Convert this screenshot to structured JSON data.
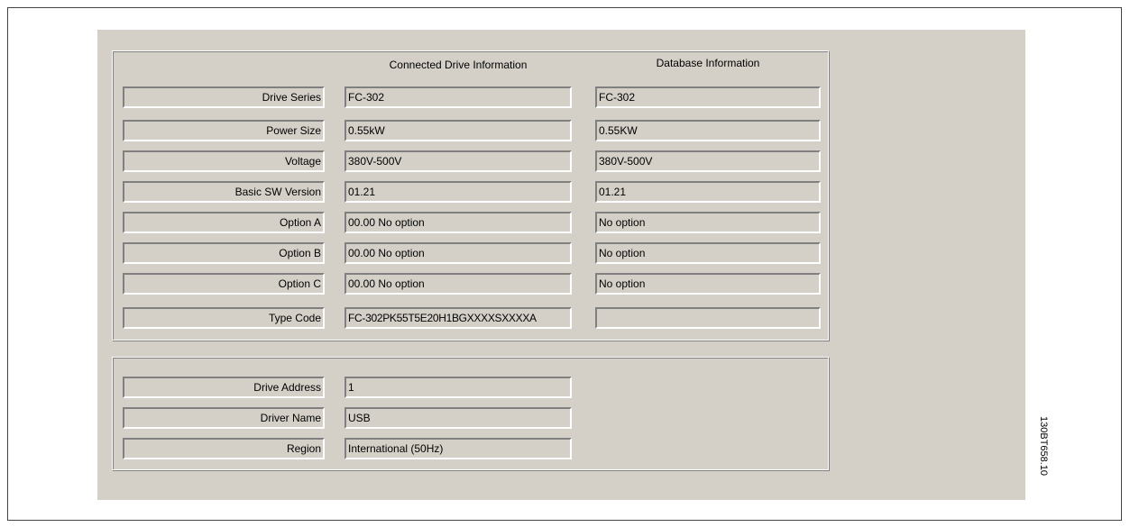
{
  "columns": {
    "connected": "Connected Drive Information",
    "database": "Database Information"
  },
  "rows": [
    {
      "label": "Drive Series",
      "connected": "FC-302",
      "database": "FC-302"
    },
    {
      "label": "Power Size",
      "connected": "0.55kW",
      "database": "0.55KW"
    },
    {
      "label": "Voltage",
      "connected": "380V-500V",
      "database": "380V-500V"
    },
    {
      "label": "Basic SW Version",
      "connected": "01.21",
      "database": "01.21"
    },
    {
      "label": "Option A",
      "connected": "00.00 No option",
      "database": "No option"
    },
    {
      "label": "Option B",
      "connected": "00.00 No option",
      "database": "No option"
    },
    {
      "label": "Option C",
      "connected": "00.00 No option",
      "database": "No option"
    },
    {
      "label": "Type Code",
      "connected": "FC-302PK55T5E20H1BGXXXXSXXXXA",
      "database": ""
    }
  ],
  "connection": [
    {
      "label": "Drive Address",
      "value": "1"
    },
    {
      "label": "Driver Name",
      "value": "USB"
    },
    {
      "label": "Region",
      "value": "International (50Hz)"
    }
  ],
  "figure_code": "130BT658.10"
}
